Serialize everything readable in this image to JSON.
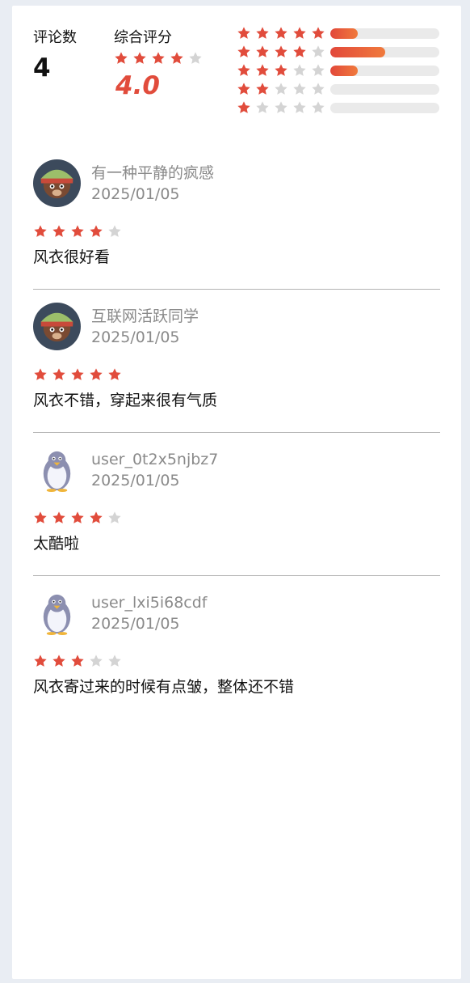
{
  "colors": {
    "star_on": "#e14c3c",
    "star_off": "#d4d4d4",
    "accent": "#e14c3c"
  },
  "summary": {
    "count_label": "评论数",
    "count_value": "4",
    "avg_label": "综合评分",
    "avg_value": "4.0",
    "avg_stars": 4,
    "distribution": [
      {
        "stars": 5,
        "fraction": 0.25
      },
      {
        "stars": 4,
        "fraction": 0.5
      },
      {
        "stars": 3,
        "fraction": 0.25
      },
      {
        "stars": 2,
        "fraction": 0
      },
      {
        "stars": 1,
        "fraction": 0
      }
    ]
  },
  "reviews": [
    {
      "name": "有一种平静的疯感",
      "date": "2025/01/05",
      "rating": 4,
      "content": "风衣很好看",
      "avatar": "user-photo-avatar"
    },
    {
      "name": "互联网活跃同学",
      "date": "2025/01/05",
      "rating": 5,
      "content": "风衣不错，穿起来很有气质",
      "avatar": "user-photo-avatar"
    },
    {
      "name": "user_0t2x5njbz7",
      "date": "2025/01/05",
      "rating": 4,
      "content": "太酷啦",
      "avatar": "penguin-avatar"
    },
    {
      "name": "user_lxi5i68cdf",
      "date": "2025/01/05",
      "rating": 3,
      "content": "风衣寄过来的时候有点皱，整体还不错",
      "avatar": "penguin-avatar"
    }
  ]
}
